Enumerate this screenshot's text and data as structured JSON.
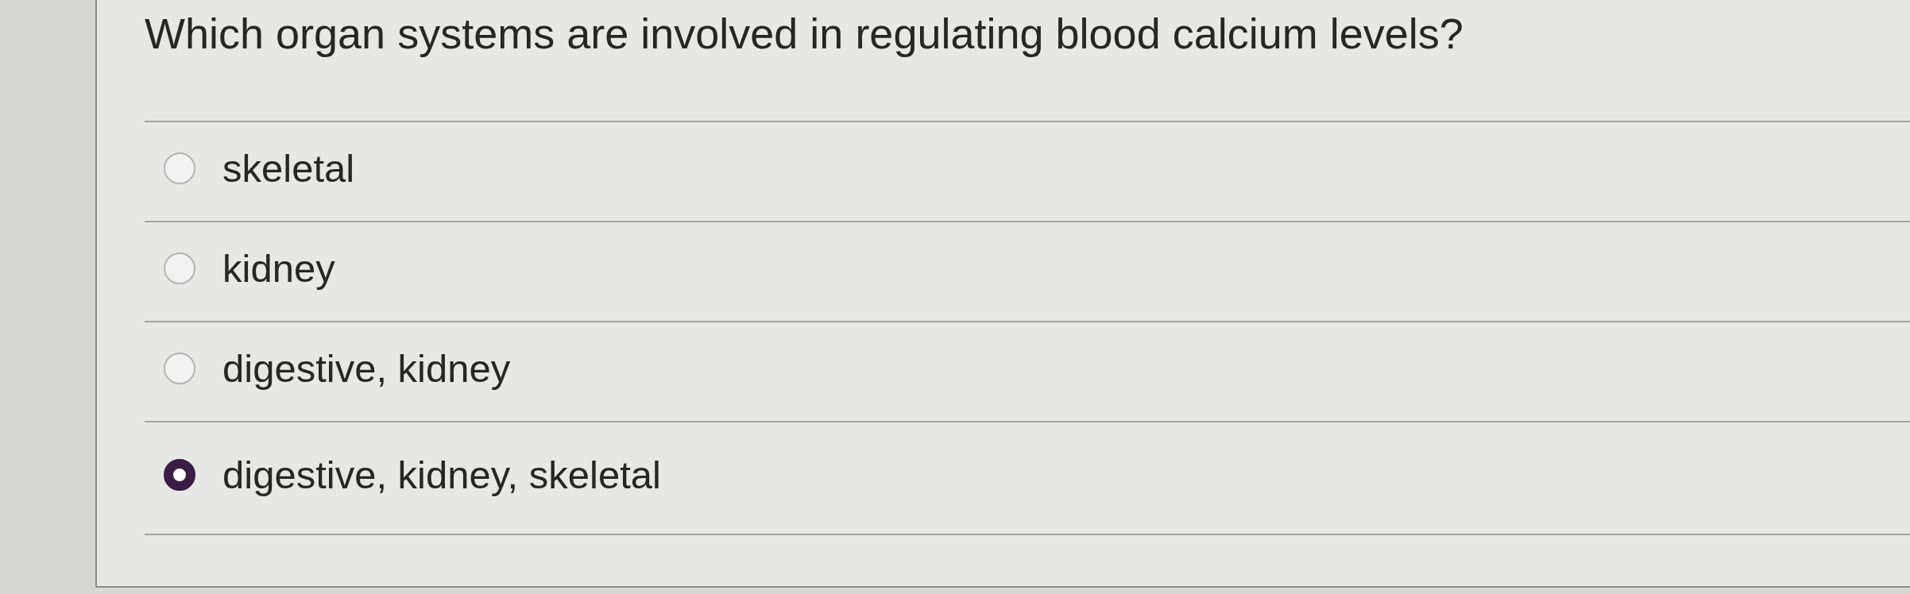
{
  "question": {
    "text": "Which organ systems are involved in regulating blood calcium levels?"
  },
  "options": [
    {
      "label": "skeletal",
      "selected": false
    },
    {
      "label": "kidney",
      "selected": false
    },
    {
      "label": "digestive, kidney",
      "selected": false
    },
    {
      "label": "digestive, kidney, skeletal",
      "selected": true
    }
  ]
}
